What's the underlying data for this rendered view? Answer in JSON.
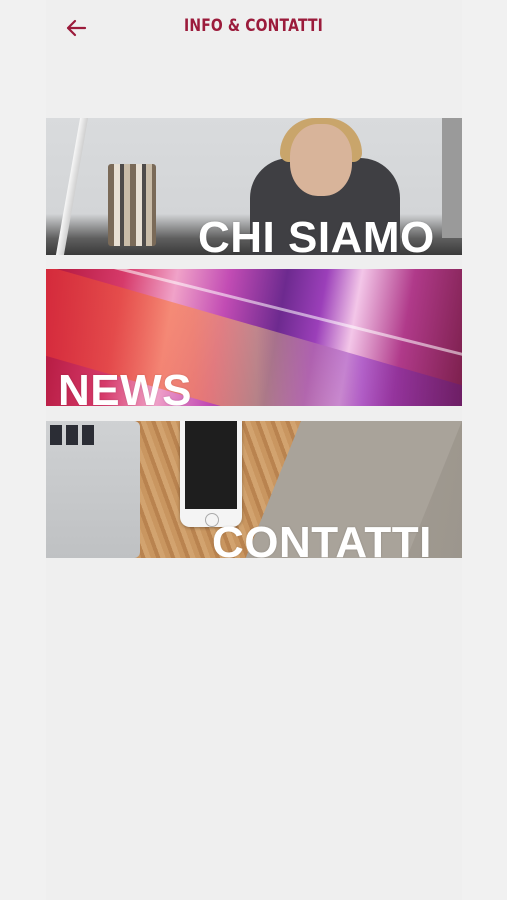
{
  "header": {
    "title": "INFO & CONTATTI",
    "back_icon": "arrow-left-icon",
    "accent_color": "#9b1b3b"
  },
  "tiles": [
    {
      "label": "CHI SIAMO"
    },
    {
      "label": "NEWS"
    },
    {
      "label": "CONTATTI"
    }
  ]
}
